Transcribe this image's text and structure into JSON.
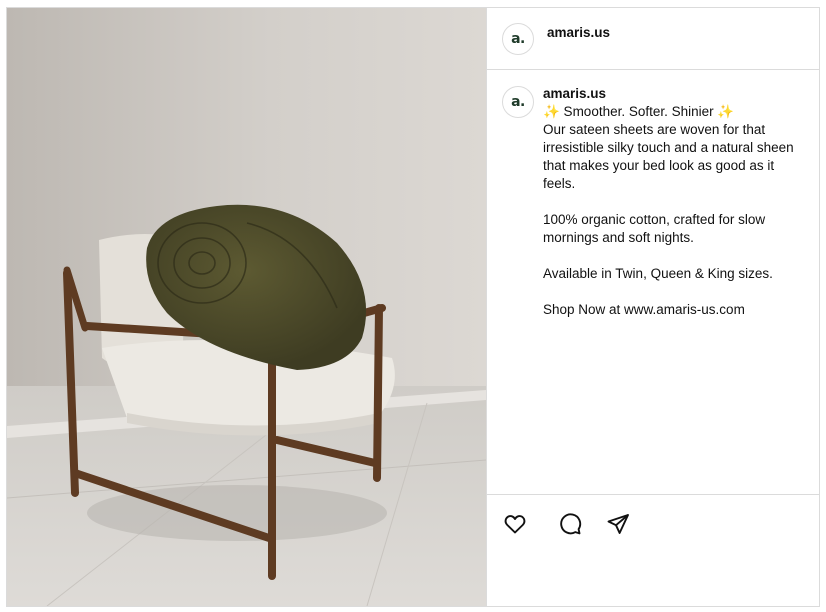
{
  "post": {
    "username": "amaris.us",
    "avatar_letter": "a."
  },
  "media": {
    "alt": "photo-armchair-with-rolled-duvet"
  },
  "caption": {
    "username": "amaris.us",
    "line1": "✨ Smoother. Softer. Shinier ✨",
    "line2": "Our sateen sheets are woven for that irresistible silky touch and a natural sheen that makes your bed look as good as it feels.",
    "line3": "100% organic cotton, crafted for slow mornings and soft nights.",
    "line4": "Available in Twin, Queen & King sizes.",
    "line5": "Shop Now at www.amaris-us.com"
  },
  "actions": {
    "icons": [
      "heart-icon",
      "comment-icon",
      "share-icon"
    ]
  },
  "colors": {
    "avatar_text": "#1f3b2a",
    "border": "#dbdbdb"
  }
}
